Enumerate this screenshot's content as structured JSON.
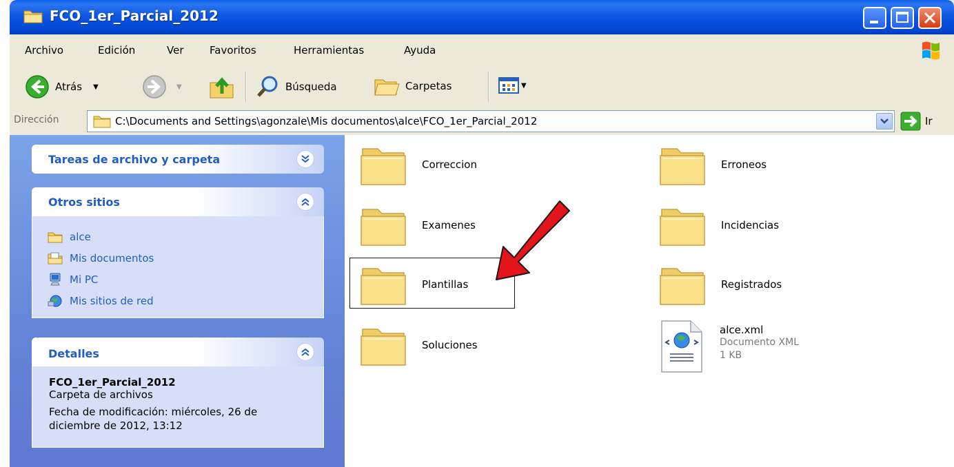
{
  "window": {
    "title": "FCO_1er_Parcial_2012"
  },
  "menu": {
    "items": [
      "Archivo",
      "Edición",
      "Ver",
      "Favoritos",
      "Herramientas",
      "Ayuda"
    ]
  },
  "toolbar": {
    "back_label": "Atrás",
    "search_label": "Búsqueda",
    "folders_label": "Carpetas"
  },
  "address": {
    "label": "Dirección",
    "path": "C:\\Documents and Settings\\agonzale\\Mis documentos\\alce\\FCO_1er_Parcial_2012",
    "go_label": "Ir"
  },
  "tasks_panel": {
    "title": "Tareas de archivo y carpeta"
  },
  "other_places": {
    "title": "Otros sitios",
    "links": [
      {
        "label": "alce",
        "icon": "folder-icon"
      },
      {
        "label": "Mis documentos",
        "icon": "my-documents-icon"
      },
      {
        "label": "Mi PC",
        "icon": "my-computer-icon"
      },
      {
        "label": "Mis sitios de red",
        "icon": "network-places-icon"
      }
    ]
  },
  "details": {
    "title": "Detalles",
    "name": "FCO_1er_Parcial_2012",
    "type": "Carpeta de archivos",
    "modified": "Fecha de modificación: miércoles, 26 de diciembre de 2012, 13:12"
  },
  "files": [
    {
      "name": "Correccion",
      "kind": "folder"
    },
    {
      "name": "Erroneos",
      "kind": "folder"
    },
    {
      "name": "Examenes",
      "kind": "folder"
    },
    {
      "name": "Incidencias",
      "kind": "folder"
    },
    {
      "name": "Plantillas",
      "kind": "folder",
      "highlighted": true
    },
    {
      "name": "Registrados",
      "kind": "folder"
    },
    {
      "name": "Soluciones",
      "kind": "folder"
    },
    {
      "name": "alce.xml",
      "kind": "file",
      "type": "Documento XML",
      "size": "1 KB"
    }
  ],
  "colors": {
    "titlebar": "#0b55e0",
    "link": "#215dc6",
    "annotation_arrow": "#e4141b",
    "side_pane": "#6485d8"
  }
}
